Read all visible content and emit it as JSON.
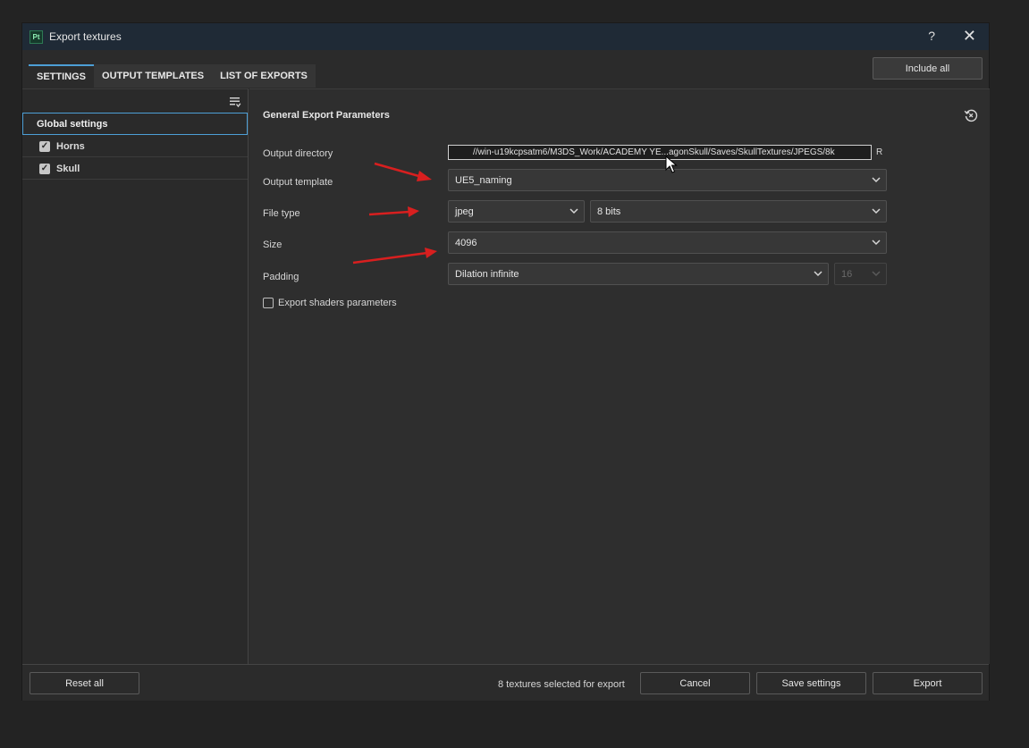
{
  "window": {
    "app_badge": "Pt",
    "title": "Export textures",
    "help_label": "?",
    "close_label": "✕"
  },
  "tabs": [
    {
      "label": "SETTINGS",
      "active": true
    },
    {
      "label": "OUTPUT TEMPLATES",
      "active": false
    },
    {
      "label": "LIST OF EXPORTS",
      "active": false
    }
  ],
  "include_all_label": "Include all",
  "tree": {
    "global_label": "Global settings",
    "items": [
      {
        "label": "Horns",
        "checked": true
      },
      {
        "label": "Skull",
        "checked": true
      }
    ]
  },
  "section_title": "General Export Parameters",
  "fields": {
    "output_directory": {
      "label": "Output directory",
      "value": "//win-u19kcpsatm6/M3DS_Work/ACADEMY YE...agonSkull/Saves/SkullTextures/JPEGS/8k",
      "suffix": "R"
    },
    "output_template": {
      "label": "Output template",
      "value": "UE5_naming"
    },
    "file_type": {
      "label": "File type",
      "format": "jpeg",
      "bit_depth": "8 bits"
    },
    "size": {
      "label": "Size",
      "value": "4096"
    },
    "padding": {
      "label": "Padding",
      "value": "Dilation infinite",
      "amount": "16"
    },
    "export_shaders": {
      "label": "Export shaders parameters",
      "checked": false
    }
  },
  "footer": {
    "reset_label": "Reset all",
    "status": "8 textures selected for export",
    "cancel_label": "Cancel",
    "save_label": "Save settings",
    "export_label": "Export"
  },
  "colors": {
    "accent": "#4d9fd6",
    "annotation_arrow": "#d81f1f",
    "titlebar": "#1f2a36"
  }
}
